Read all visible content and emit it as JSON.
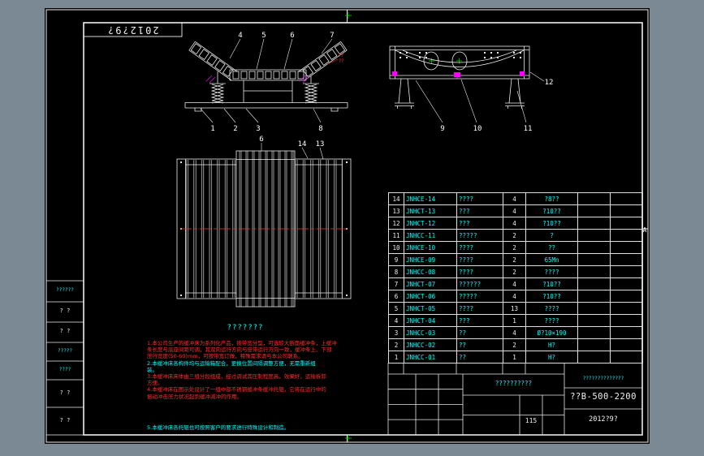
{
  "colors": {
    "line": "#efefef",
    "accent_cyan": "#00ffff",
    "note_red": "#ff2d2d",
    "centerline_red": "#ff3030",
    "mark_magenta": "#ff00ff",
    "blip_green": "#00dd00",
    "background": "#7b8995"
  },
  "sheet": {
    "corner_code": "2012?9?",
    "zone_label": "A",
    "plan_title": "???????",
    "margin_boxes": {
      "b1": "??????",
      "b2_r1": "? ?",
      "b2_r2": "? ?",
      "b3_r1": "?????",
      "b3_r2": "????",
      "b4_r1": "? ?",
      "b4_r2": "? ?"
    }
  },
  "labels": {
    "front": [
      "4",
      "5",
      "6",
      "7",
      "1",
      "2",
      "3",
      "8"
    ],
    "end": [
      "9",
      "10",
      "11",
      "12"
    ],
    "plan": [
      "6",
      "14",
      "13"
    ]
  },
  "annotations": {
    "weld_1": "??",
    "weld_2": "??"
  },
  "bom": {
    "rows": [
      [
        "14",
        "JNHCE-14",
        "????",
        "4",
        "?8??",
        "",
        ""
      ],
      [
        "13",
        "JNHCT-13",
        "???",
        "4",
        "?10??",
        "",
        ""
      ],
      [
        "12",
        "JNHCT-12",
        "???",
        "4",
        "?10??",
        "",
        ""
      ],
      [
        "11",
        "JNHCC-11",
        "?????",
        "2",
        "?",
        "",
        ""
      ],
      [
        "10",
        "JNHCE-10",
        "????",
        "2",
        "??",
        "",
        ""
      ],
      [
        "9",
        "JNHCE-09",
        "????",
        "2",
        "65Mn",
        "",
        ""
      ],
      [
        "8",
        "JNHCC-08",
        "????",
        "2",
        "????",
        "",
        ""
      ],
      [
        "7",
        "JNHCT-07",
        "??????",
        "4",
        "?10??",
        "",
        ""
      ],
      [
        "6",
        "JNHCT-06",
        "?????",
        "4",
        "?10??",
        "",
        ""
      ],
      [
        "5",
        "JNHCT-05",
        "????",
        "13",
        "????",
        "",
        ""
      ],
      [
        "4",
        "JNHCT-04",
        "???",
        "1",
        "????",
        "",
        ""
      ],
      [
        "3",
        "JNHCC-03",
        "??",
        "4",
        "Ø?10×190",
        "",
        ""
      ],
      [
        "2",
        "JNHCC-02",
        "??",
        "2",
        "H?",
        "",
        ""
      ],
      [
        "1",
        "JNHCC-01",
        "??",
        "1",
        "H?",
        "",
        ""
      ]
    ]
  },
  "notes": [
    {
      "text": "1.本公司生产的缓冲床为系列化产品，按带宽分型，可选较大断面缓冲条，上缓冲",
      "color": "red"
    },
    {
      "text": "条长度与底座间距可调，其双向运行方向与皮带运行方向一致，缓冲条上、下部",
      "color": "red"
    },
    {
      "text": "压行宽度(50-60)mm，可按带宽订做，特殊需求请与本公司联系。",
      "color": "red"
    },
    {
      "text": "2.本缓冲床各构件均与运输箱配合，更换位置间隔调整方便，无需重新组",
      "color": "cyan"
    },
    {
      "text": "装。",
      "color": "cyan"
    },
    {
      "text": "3.本缓冲床床体由三组分段组成，经过调试其压制程度高，效果好，运输拆卸",
      "color": "red"
    },
    {
      "text": "方便。",
      "color": "red"
    },
    {
      "text": "4.本缓冲床在图示处设计了一组中部不锈钢缓冲条缓冲托辊，它将在运行中的",
      "color": "red"
    },
    {
      "text": "振动冲击压力状况起到缓冲减冲的作用。",
      "color": "red"
    },
    {
      "text": "5.本缓冲床各托辊也可按照客户的要求进行特殊设计和制造。",
      "color": "cyan"
    }
  ],
  "title_block": {
    "product_name": "??????????",
    "company": "??????????????",
    "drawing_no": "??B-500-2200",
    "date": "2012?9?",
    "weight": "115"
  }
}
